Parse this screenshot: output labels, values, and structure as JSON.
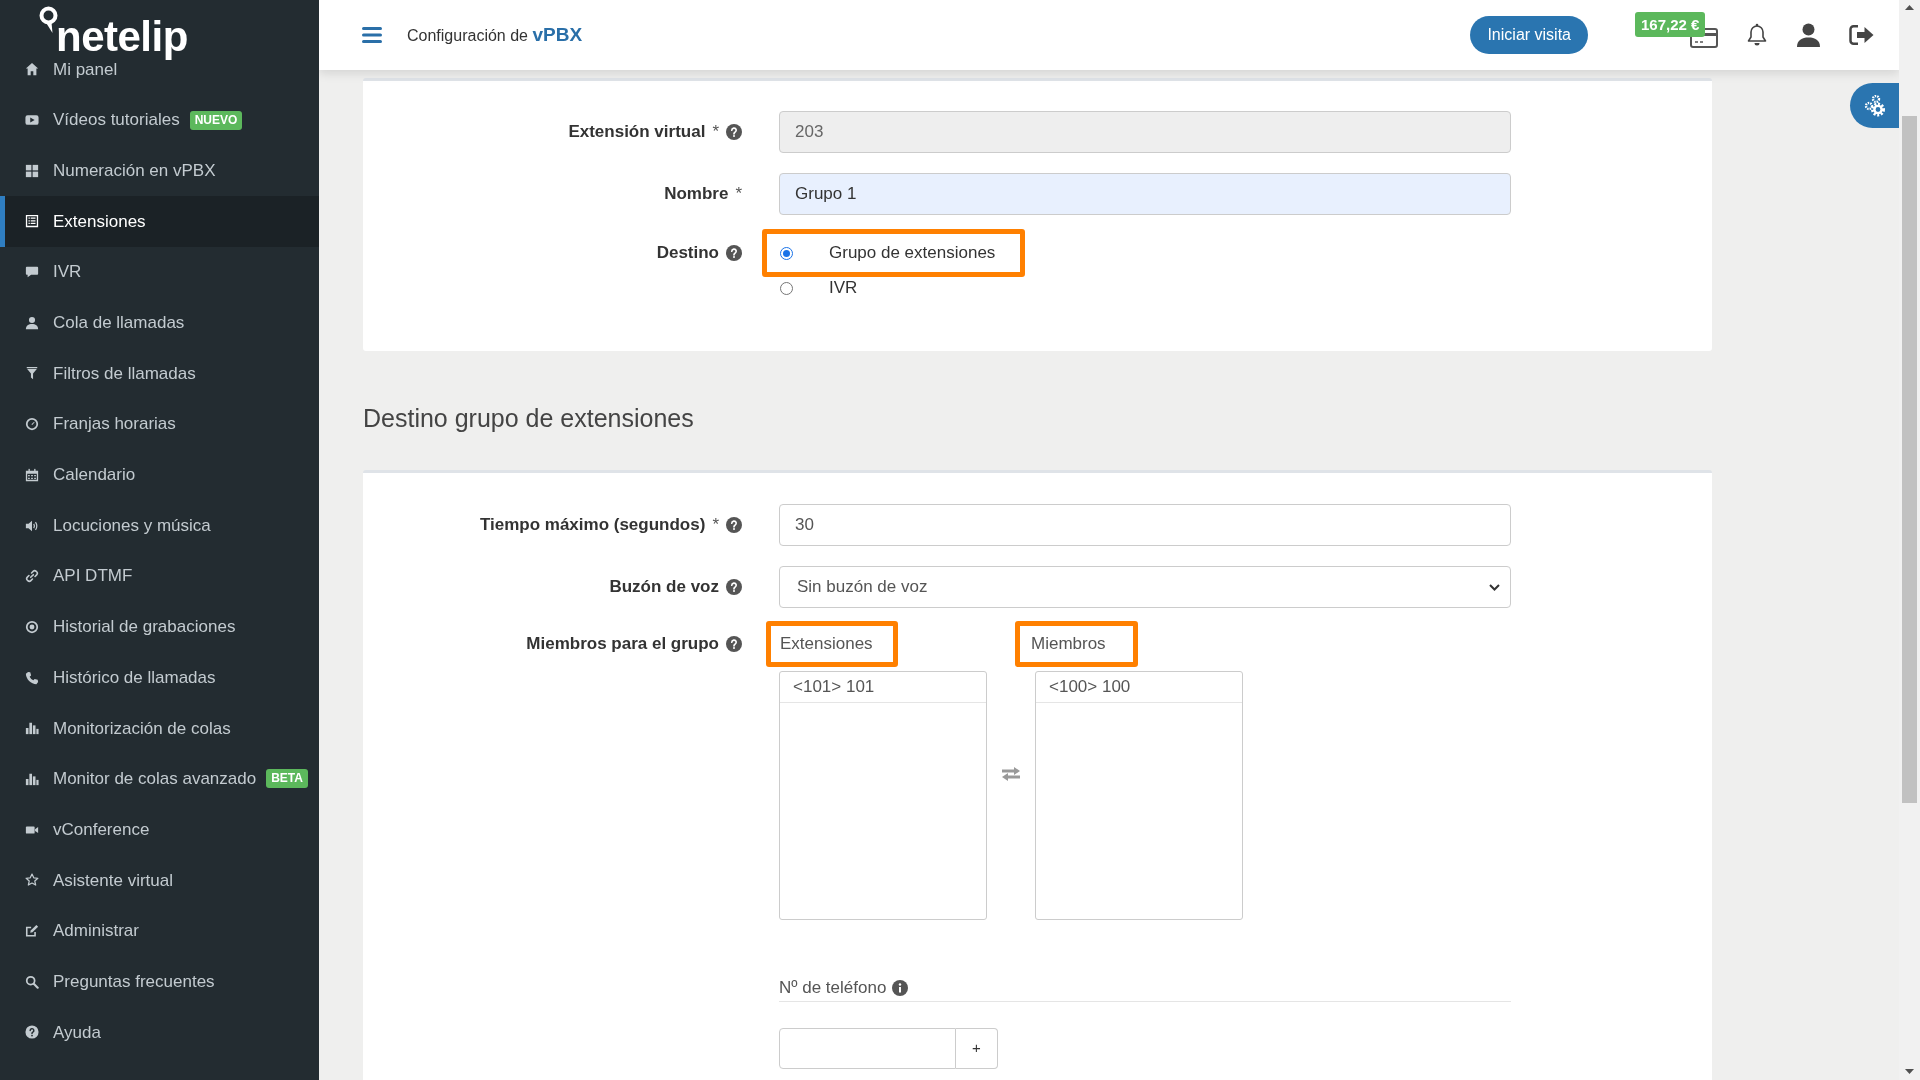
{
  "sidebar": {
    "logo": "netelip",
    "items": [
      {
        "label": "Mi panel",
        "selected": false
      },
      {
        "label": "Vídeos tutoriales",
        "badge": "NUEVO",
        "selected": false
      },
      {
        "label": "Numeración en vPBX",
        "selected": false
      },
      {
        "label": "Extensiones",
        "selected": true
      },
      {
        "label": "IVR",
        "selected": false
      },
      {
        "label": "Cola de llamadas",
        "selected": false
      },
      {
        "label": "Filtros de llamadas",
        "selected": false
      },
      {
        "label": "Franjas horarias",
        "selected": false
      },
      {
        "label": "Calendario",
        "selected": false
      },
      {
        "label": "Locuciones y música",
        "selected": false
      },
      {
        "label": "API DTMF",
        "selected": false
      },
      {
        "label": "Historial de grabaciones",
        "selected": false
      },
      {
        "label": "Histórico de llamadas",
        "selected": false
      },
      {
        "label": "Monitorización de colas",
        "selected": false
      },
      {
        "label": "Monitor de colas avanzado",
        "badge": "BETA",
        "selected": false
      },
      {
        "label": "vConference",
        "selected": false
      },
      {
        "label": "Asistente virtual",
        "selected": false
      },
      {
        "label": "Administrar",
        "selected": false
      },
      {
        "label": "Preguntas frecuentes",
        "selected": false
      },
      {
        "label": "Ayuda",
        "selected": false
      }
    ]
  },
  "topbar": {
    "title": "Configuración de **vPBX**",
    "visit_button": "Iniciar visita",
    "balance": "167,22 €"
  },
  "settings_card": {
    "fields": [
      {
        "kind": "text",
        "label": "Extensión virtual",
        "required_mark": "*",
        "help": true,
        "value": "203",
        "disabled": true
      },
      {
        "kind": "text",
        "label": "Nombre",
        "required_mark": "*",
        "help": false,
        "value": "Grupo 1",
        "disabled": false,
        "autofilled": true
      },
      {
        "kind": "radio",
        "label": "Destino",
        "help": true,
        "options": [
          {
            "label": "Grupo de extensiones",
            "selected": true,
            "highlighted": true
          },
          {
            "label": "IVR",
            "selected": false,
            "highlighted": false
          }
        ]
      }
    ]
  },
  "group_section": {
    "heading": "Destino grupo de extensiones",
    "fields": [
      {
        "kind": "text",
        "label": "Tiempo máximo (segundos)",
        "required_mark": "*",
        "help": true,
        "value": "30",
        "disabled": false,
        "autofilled": false
      },
      {
        "kind": "select",
        "label": "Buzón de voz",
        "help": true,
        "value": "Sin buzón de voz"
      },
      {
        "kind": "dual_list",
        "label": "Miembros para el grupo",
        "help": true,
        "lists": [
          {
            "title": "Extensiones",
            "highlighted": true,
            "items": [
              {
                "label": "<101> 101",
                "selected": false
              }
            ]
          },
          {
            "title": "Miembros",
            "highlighted": true,
            "items": [
              {
                "label": "<100> 100",
                "selected": false
              }
            ]
          }
        ]
      }
    ],
    "phone": {
      "label": "Nº de teléfono",
      "add_button": "+"
    }
  }
}
